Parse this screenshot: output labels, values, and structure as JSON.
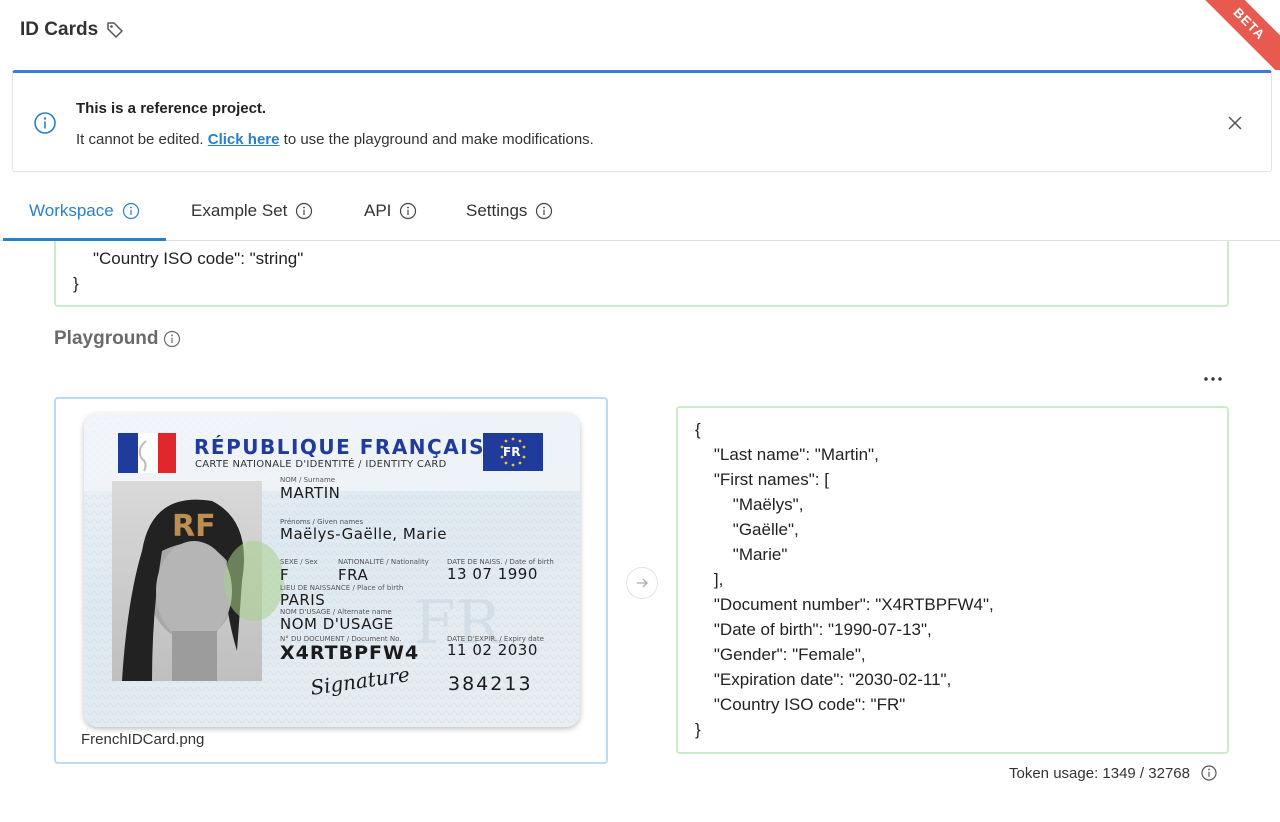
{
  "header": {
    "title": "ID Cards",
    "beta": "BETA"
  },
  "alert": {
    "title": "This is a reference project.",
    "body_before": "It cannot be edited. ",
    "link": "Click here",
    "body_after": " to use the playground and make modifications."
  },
  "tabs": [
    {
      "label": "Workspace",
      "active": true
    },
    {
      "label": "Example Set",
      "active": false
    },
    {
      "label": "API",
      "active": false
    },
    {
      "label": "Settings",
      "active": false
    }
  ],
  "schema": {
    "line1": "\"Country ISO code\": \"string\"",
    "line2": "}"
  },
  "playground": {
    "title": "Playground",
    "file_name": "FrenchIDCard.png",
    "token_usage": "Token usage: 1349 / 32768"
  },
  "card": {
    "republic": "RÉPUBLIQUE FRANÇAISE",
    "subtitle": "CARTE NATIONALE D'IDENTITÉ / IDENTITY CARD",
    "eu_code": "FR",
    "surname_label": "NOM / Surname",
    "surname": "MARTIN",
    "given_label": "Prénoms / Given names",
    "given": "Maëlys-Gaëlle, Marie",
    "sex_label": "SEXE / Sex",
    "sex": "F",
    "nationality_label": "NATIONALITÉ / Nationality",
    "nationality": "FRA",
    "dob_label": "DATE DE NAISS. / Date of birth",
    "dob": "13 07 1990",
    "pob_label": "LIEU DE NAISSANCE / Place of birth",
    "pob": "PARIS",
    "usage_label": "NOM D'USAGE / Alternate name",
    "usage": "NOM D'USAGE",
    "docno_label": "N° DU DOCUMENT / Document No.",
    "docno": "X4RTBPFW4",
    "expiry_label": "DATE D'EXPIR. / Expiry date",
    "expiry": "11 02 2030",
    "signature": "Signature",
    "code": "384213",
    "watermark": "RF"
  },
  "result": {
    "lines": [
      "{",
      "    \"Last name\": \"Martin\",",
      "    \"First names\": [",
      "        \"Maëlys\",",
      "        \"Gaëlle\",",
      "        \"Marie\"",
      "    ],",
      "    \"Document number\": \"X4RTBPFW4\",",
      "    \"Date of birth\": \"1990-07-13\",",
      "    \"Gender\": \"Female\",",
      "    \"Expiration date\": \"2030-02-11\",",
      "    \"Country ISO code\": \"FR\"",
      "}"
    ]
  },
  "colors": {
    "accent": "#2a7fc9",
    "success_border": "#cbeccb",
    "image_border": "#b9dcf2",
    "beta": "#e85a4f"
  },
  "icons": {
    "tag": "tag-icon",
    "info": "info-icon",
    "close": "close-icon",
    "more": "more-horizontal-icon",
    "arrow": "arrow-right-icon"
  }
}
